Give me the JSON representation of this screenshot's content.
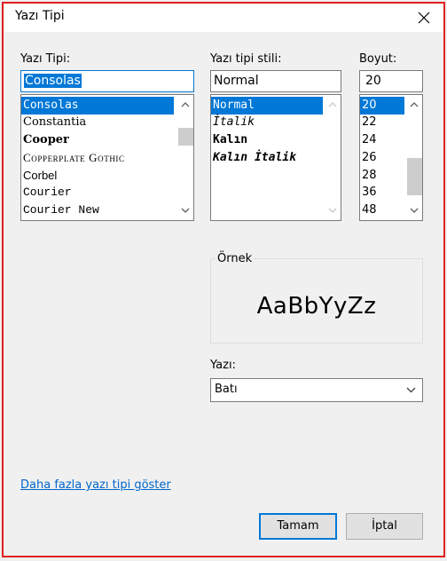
{
  "window": {
    "title": "Yazı Tipi"
  },
  "font": {
    "label": "Yazı Tipi:",
    "value": "Consolas",
    "items": [
      "Consolas",
      "Constantia",
      "Cooper",
      "Copperplate Gothic",
      "Corbel",
      "Courier",
      "Courier New"
    ],
    "selected_index": 0
  },
  "style": {
    "label": "Yazı tipi stili:",
    "value": "Normal",
    "items": [
      "Normal",
      "İtalik",
      "Kalın",
      "Kalın İtalik"
    ],
    "selected_index": 0
  },
  "size": {
    "label": "Boyut:",
    "value": "20",
    "items": [
      "20",
      "22",
      "24",
      "26",
      "28",
      "36",
      "48"
    ],
    "selected_index": 0
  },
  "sample": {
    "legend": "Örnek",
    "text": "AaBbYyZz"
  },
  "script": {
    "label": "Yazı:",
    "value": "Batı"
  },
  "more_fonts_link": "Daha fazla yazı tipi göster",
  "buttons": {
    "ok": "Tamam",
    "cancel": "İptal"
  },
  "colors": {
    "selection": "#0078d7",
    "link": "#0066cc",
    "outline": "#e02020"
  },
  "icons": [
    "close-icon",
    "chevron-up-icon",
    "chevron-down-icon"
  ]
}
